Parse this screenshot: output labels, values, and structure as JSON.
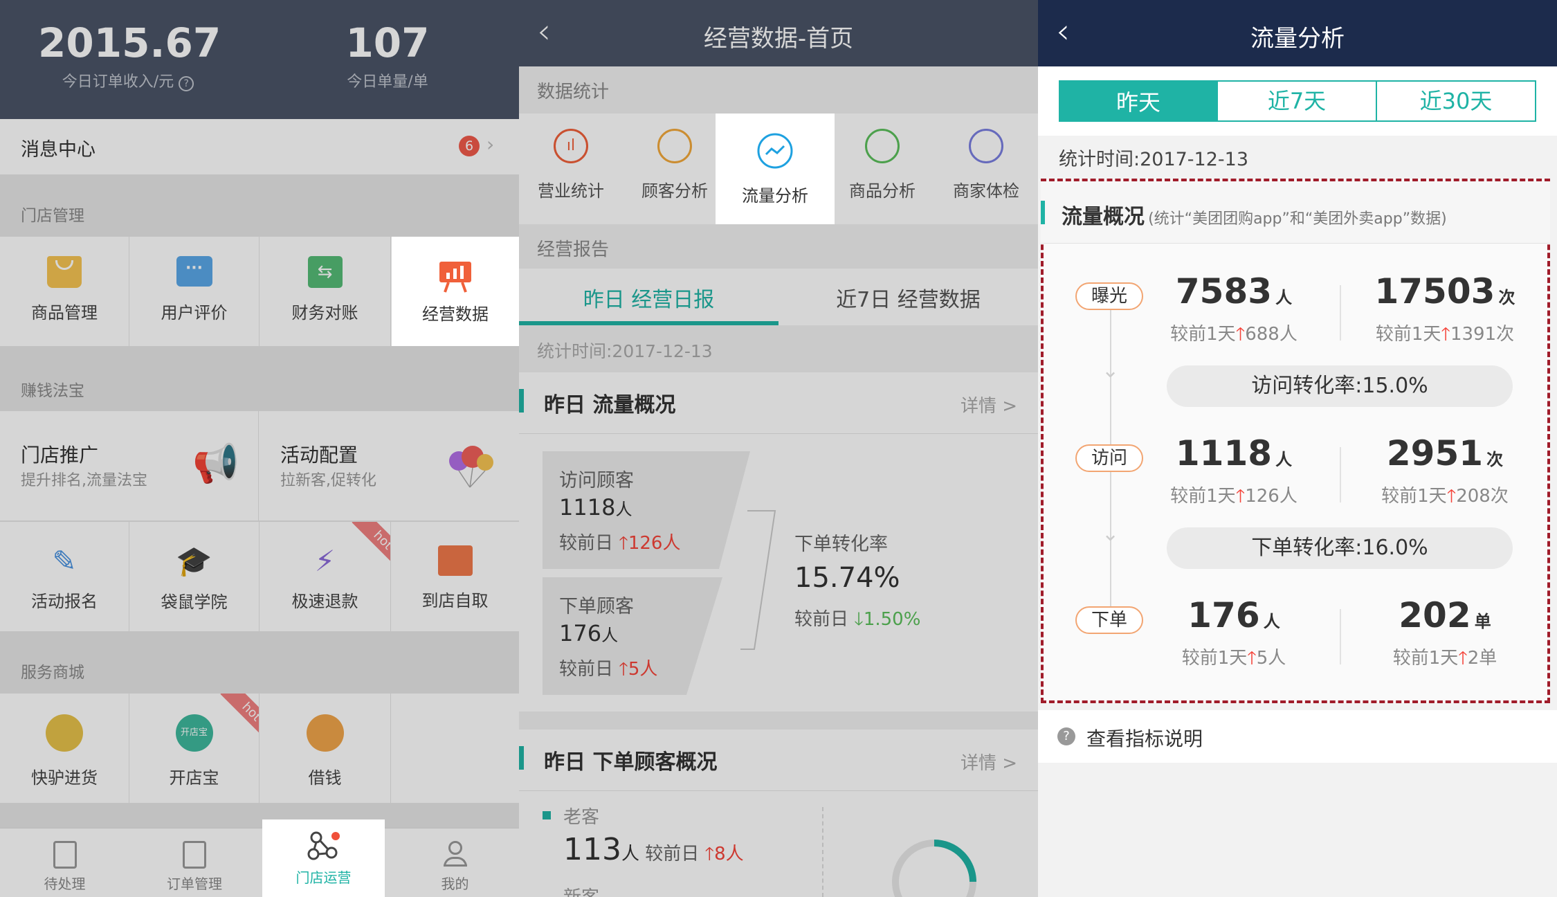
{
  "p1": {
    "revenue_value": "2015.67",
    "revenue_label": "今日订单收入/元",
    "orders_value": "107",
    "orders_label": "今日单量/单",
    "msg_center": "消息中心",
    "msg_badge": "6",
    "store_mgmt": "门店管理",
    "store_items": [
      "商品管理",
      "用户评价",
      "财务对账",
      "经营数据"
    ],
    "earn": "赚钱法宝",
    "promo_title": "门店推广",
    "promo_sub": "提升排名,流量法宝",
    "activity_title": "活动配置",
    "activity_sub": "拉新客,促转化",
    "tools": [
      "活动报名",
      "袋鼠学院",
      "极速退款",
      "到店自取"
    ],
    "hot": "hot",
    "service": "服务商城",
    "svc_items": [
      "快驴进货",
      "开店宝",
      "借钱"
    ],
    "kaidianbao_logo": "开店宝",
    "tabbar": [
      "待处理",
      "订单管理",
      "门店运营",
      "我的"
    ]
  },
  "p2": {
    "title": "经营数据-首页",
    "stats_header": "数据统计",
    "stats_items": [
      "营业统计",
      "顾客分析",
      "流量分析",
      "商品分析",
      "商家体检"
    ],
    "report_header": "经营报告",
    "report_tabs": [
      "昨日 经营日报",
      "近7日 经营数据"
    ],
    "stat_time": "统计时间:2017-12-13",
    "flow_title": "昨日 流量概况",
    "detail": "详情 >",
    "visit_label": "访问顾客",
    "visit_value": "1118",
    "unit_ren": "人",
    "compare": "较前日",
    "visit_delta": "126人",
    "order_label": "下单顾客",
    "order_value": "176",
    "order_delta": "5人",
    "rate_label": "下单转化率",
    "rate_value": "15.74%",
    "rate_delta": "1.50%",
    "cust_title": "昨日 下单顾客概况",
    "old_label": "老客",
    "old_value": "113",
    "old_delta": "8人",
    "new_label": "新客"
  },
  "p3": {
    "title": "流量分析",
    "tabs": [
      "昨天",
      "近7天",
      "近30天"
    ],
    "stat_time": "统计时间:2017-12-13",
    "overview_title": "流量概况",
    "overview_note": "(统计“美团团购app”和“美团外卖app”数据)",
    "stages": [
      {
        "name": "曝光",
        "v1": "7583",
        "u1": "人",
        "d1": "688人",
        "v2": "17503",
        "u2": "次",
        "d2": "1391次"
      },
      {
        "name": "访问",
        "v1": "1118",
        "u1": "人",
        "d1": "126人",
        "v2": "2951",
        "u2": "次",
        "d2": "208次"
      },
      {
        "name": "下单",
        "v1": "176",
        "u1": "人",
        "d1": "5人",
        "v2": "202",
        "u2": "单",
        "d2": "2单"
      }
    ],
    "compare": "较前1天",
    "rate1": "访问转化率:15.0%",
    "rate2": "下单转化率:16.0%",
    "help": "查看指标说明",
    "help_icon": "?"
  },
  "colors": {
    "teal": "#1fb3a5",
    "orange": "#f0603a",
    "red": "#f5443a",
    "green": "#5bbf5b",
    "dark_header": "#1c2b4c",
    "slate_header": "#4a5467"
  },
  "arrows": {
    "up": "🡑",
    "down": "🡓"
  }
}
